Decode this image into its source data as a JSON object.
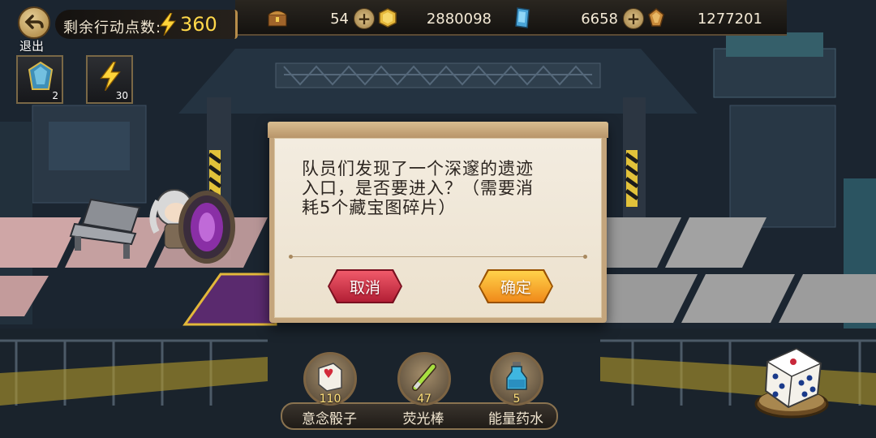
{
  "hud": {
    "back_label": "退出",
    "action_points_label": "剩余行动点数:",
    "action_points_value": "360",
    "resources": [
      {
        "icon": "treasure-chest-icon",
        "value": "54",
        "has_plus": true
      },
      {
        "icon": "gold-coin-icon",
        "value": "2880098",
        "has_plus": false
      },
      {
        "icon": "blue-crystal-icon",
        "value": "6658",
        "has_plus": true
      },
      {
        "icon": "amber-gem-icon",
        "value": "1277201",
        "has_plus": false
      }
    ],
    "items": [
      {
        "icon": "blue-gem-icon",
        "count": "2"
      },
      {
        "icon": "lightning-icon",
        "count": "30"
      }
    ]
  },
  "dialog": {
    "message": "队员们发现了一个深邃的遗迹入口，是否要进入？（需要消耗5个藏宝图碎片）",
    "message_lines": [
      "队员们发现了一个深邃的遗迹",
      "入口，是否要进入？（需要消",
      "耗5个藏宝图碎片）"
    ],
    "cancel_label": "取消",
    "confirm_label": "确定"
  },
  "tools": [
    {
      "name": "意念骰子",
      "count": "110",
      "icon": "dice-card-icon"
    },
    {
      "name": "荧光棒",
      "count": "47",
      "icon": "glow-stick-icon"
    },
    {
      "name": "能量药水",
      "count": "5",
      "icon": "potion-icon"
    }
  ],
  "colors": {
    "gold_text": "#ffd84a",
    "cancel_button": "#d9334a",
    "confirm_button": "#f7ad2c",
    "dialog_bg": "#efe6d6"
  }
}
